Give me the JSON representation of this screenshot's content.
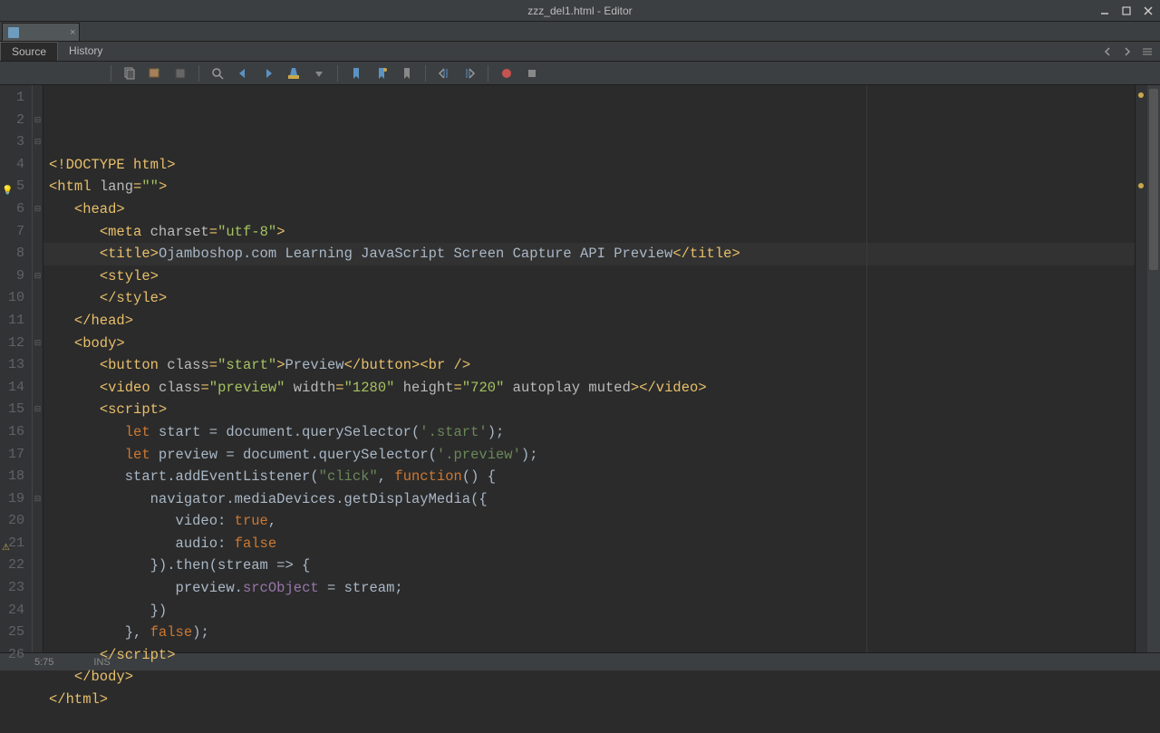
{
  "window": {
    "title": "zzz_del1.html - Editor"
  },
  "tabs": {
    "source": "Source",
    "history": "History"
  },
  "status": {
    "position": "5:75",
    "mode": "INS"
  },
  "code": {
    "lines": [
      {
        "n": 1,
        "segs": [
          {
            "c": "t-tag",
            "t": "<!DOCTYPE html>"
          }
        ]
      },
      {
        "n": 2,
        "segs": [
          {
            "c": "t-tag",
            "t": "<html "
          },
          {
            "c": "t-attr",
            "t": "lang"
          },
          {
            "c": "t-tag",
            "t": "="
          },
          {
            "c": "t-str",
            "t": "\"\""
          },
          {
            "c": "t-tag",
            "t": ">"
          }
        ]
      },
      {
        "n": 3,
        "indent": 1,
        "segs": [
          {
            "c": "t-tag",
            "t": "<head>"
          }
        ]
      },
      {
        "n": 4,
        "indent": 2,
        "segs": [
          {
            "c": "t-tag",
            "t": "<meta "
          },
          {
            "c": "t-attr",
            "t": "charset"
          },
          {
            "c": "t-tag",
            "t": "="
          },
          {
            "c": "t-str",
            "t": "\"utf-8\""
          },
          {
            "c": "t-tag",
            "t": ">"
          }
        ]
      },
      {
        "n": 5,
        "hl": true,
        "indent": 2,
        "mark": "bulb",
        "segs": [
          {
            "c": "t-tag",
            "t": "<title>"
          },
          {
            "c": "t-text",
            "t": "Ojamboshop.com Learning JavaScript Screen Capture API Preview"
          },
          {
            "c": "t-tag",
            "t": "</title>"
          }
        ]
      },
      {
        "n": 6,
        "indent": 2,
        "segs": [
          {
            "c": "t-tag",
            "t": "<style>"
          }
        ]
      },
      {
        "n": 7,
        "indent": 2,
        "segs": [
          {
            "c": "t-tag",
            "t": "</style>"
          }
        ]
      },
      {
        "n": 8,
        "indent": 1,
        "segs": [
          {
            "c": "t-tag",
            "t": "</head>"
          }
        ]
      },
      {
        "n": 9,
        "indent": 1,
        "segs": [
          {
            "c": "t-tag",
            "t": "<body>"
          }
        ]
      },
      {
        "n": 10,
        "indent": 2,
        "segs": [
          {
            "c": "t-tag",
            "t": "<button "
          },
          {
            "c": "t-attr",
            "t": "class"
          },
          {
            "c": "t-tag",
            "t": "="
          },
          {
            "c": "t-str",
            "t": "\"start\""
          },
          {
            "c": "t-tag",
            "t": ">"
          },
          {
            "c": "t-text",
            "t": "Preview"
          },
          {
            "c": "t-tag",
            "t": "</button><br />"
          }
        ]
      },
      {
        "n": 11,
        "indent": 2,
        "segs": [
          {
            "c": "t-tag",
            "t": "<video "
          },
          {
            "c": "t-attr",
            "t": "class"
          },
          {
            "c": "t-tag",
            "t": "="
          },
          {
            "c": "t-str",
            "t": "\"preview\""
          },
          {
            "c": "t-attr",
            "t": " width"
          },
          {
            "c": "t-tag",
            "t": "="
          },
          {
            "c": "t-str",
            "t": "\"1280\""
          },
          {
            "c": "t-attr",
            "t": " height"
          },
          {
            "c": "t-tag",
            "t": "="
          },
          {
            "c": "t-str",
            "t": "\"720\""
          },
          {
            "c": "t-attr",
            "t": " autoplay muted"
          },
          {
            "c": "t-tag",
            "t": "></video>"
          }
        ]
      },
      {
        "n": 12,
        "indent": 2,
        "segs": [
          {
            "c": "t-tag",
            "t": "<script>"
          }
        ]
      },
      {
        "n": 13,
        "indent": 3,
        "segs": [
          {
            "c": "t-kw",
            "t": "let"
          },
          {
            "c": "t-text",
            "t": " start = document.querySelector("
          },
          {
            "c": "t-sel",
            "t": "'.start'"
          },
          {
            "c": "t-text",
            "t": ");"
          }
        ]
      },
      {
        "n": 14,
        "indent": 3,
        "segs": [
          {
            "c": "t-kw",
            "t": "let"
          },
          {
            "c": "t-text",
            "t": " preview = document.querySelector("
          },
          {
            "c": "t-sel",
            "t": "'.preview'"
          },
          {
            "c": "t-text",
            "t": ");"
          }
        ]
      },
      {
        "n": 15,
        "indent": 3,
        "segs": [
          {
            "c": "t-text",
            "t": "start.addEventListener("
          },
          {
            "c": "t-sel",
            "t": "\"click\""
          },
          {
            "c": "t-text",
            "t": ", "
          },
          {
            "c": "t-kw",
            "t": "function"
          },
          {
            "c": "t-text",
            "t": "() {"
          }
        ]
      },
      {
        "n": 16,
        "indent": 4,
        "segs": [
          {
            "c": "t-text",
            "t": "navigator.mediaDevices.getDisplayMedia({"
          }
        ]
      },
      {
        "n": 17,
        "indent": 5,
        "segs": [
          {
            "c": "t-text",
            "t": "video: "
          },
          {
            "c": "t-kw",
            "t": "true"
          },
          {
            "c": "t-text",
            "t": ","
          }
        ]
      },
      {
        "n": 18,
        "indent": 5,
        "segs": [
          {
            "c": "t-text",
            "t": "audio: "
          },
          {
            "c": "t-kw",
            "t": "false"
          }
        ]
      },
      {
        "n": 19,
        "indent": 4,
        "segs": [
          {
            "c": "t-text",
            "t": "}).then(stream => {"
          }
        ]
      },
      {
        "n": 20,
        "indent": 5,
        "segs": [
          {
            "c": "t-text",
            "t": "preview."
          },
          {
            "c": "t-prop",
            "t": "srcObject"
          },
          {
            "c": "t-text",
            "t": " = stream;"
          }
        ]
      },
      {
        "n": 21,
        "indent": 4,
        "mark": "warn",
        "segs": [
          {
            "c": "t-text",
            "t": "})"
          }
        ]
      },
      {
        "n": 22,
        "indent": 3,
        "segs": [
          {
            "c": "t-text",
            "t": "}, "
          },
          {
            "c": "t-kw",
            "t": "false"
          },
          {
            "c": "t-text",
            "t": ");"
          }
        ]
      },
      {
        "n": 23,
        "indent": 2,
        "segs": [
          {
            "c": "t-tag",
            "t": "</script>"
          }
        ]
      },
      {
        "n": 24,
        "indent": 1,
        "segs": [
          {
            "c": "t-tag",
            "t": "</body>"
          }
        ]
      },
      {
        "n": 25,
        "segs": [
          {
            "c": "t-tag",
            "t": "</html>"
          }
        ]
      },
      {
        "n": 26,
        "segs": []
      }
    ]
  }
}
